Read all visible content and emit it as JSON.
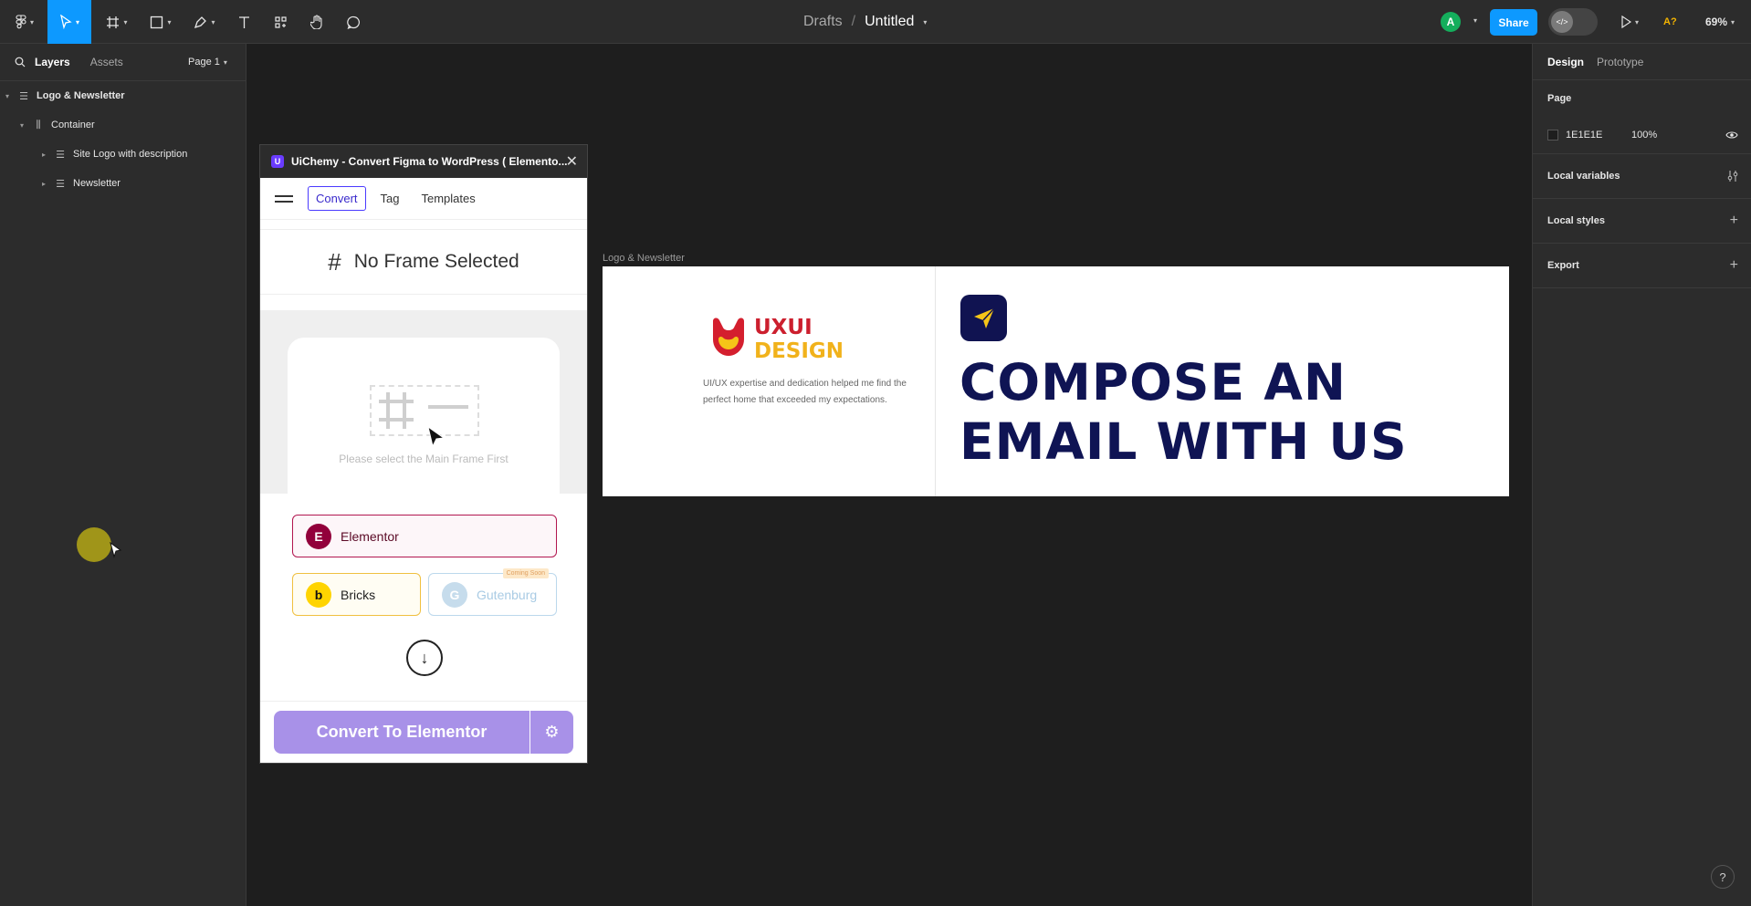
{
  "toolbar": {
    "breadcrumb_parent": "Drafts",
    "breadcrumb_sep": "/",
    "file_name": "Untitled",
    "avatar_initial": "A",
    "share_label": "Share",
    "font_warning": "A?",
    "zoom": "69%",
    "accent": "#0d99ff"
  },
  "left_panel": {
    "tabs": [
      "Layers",
      "Assets"
    ],
    "page_selector": "Page 1",
    "layers": [
      {
        "label": "Logo & Newsletter",
        "indent": 0,
        "bold": true
      },
      {
        "label": "Container",
        "indent": 1,
        "bold": false
      },
      {
        "label": "Site Logo with description",
        "indent": 2,
        "bold": false
      },
      {
        "label": "Newsletter",
        "indent": 2,
        "bold": false
      }
    ]
  },
  "right_panel": {
    "tabs": [
      "Design",
      "Prototype"
    ],
    "page_title": "Page",
    "page_color": "1E1E1E",
    "page_opacity": "100%",
    "sections": [
      "Local variables",
      "Local styles",
      "Export"
    ]
  },
  "canvas": {
    "frame_label": "Logo & Newsletter",
    "logo_line1": "UXUI",
    "logo_line2": "DESIGN",
    "logo_description": "UI/UX expertise and dedication helped me find the perfect home that exceeded my expectations.",
    "headline": "COMPOSE AN\nEMAIL WITH US",
    "headline_color": "#0f1454"
  },
  "plugin": {
    "title": "UiChemy - Convert Figma to WordPress ( Elemento...",
    "tabs": [
      "Convert",
      "Tag",
      "Templates"
    ],
    "active_tab": "Convert",
    "frame_status": "No Frame Selected",
    "select_hint": "Please select the Main Frame First",
    "builders": {
      "elementor": "Elementor",
      "bricks": "Bricks",
      "gutenburg": "Gutenburg",
      "coming_soon": "Coming Soon"
    },
    "convert_button": "Convert To Elementor"
  }
}
